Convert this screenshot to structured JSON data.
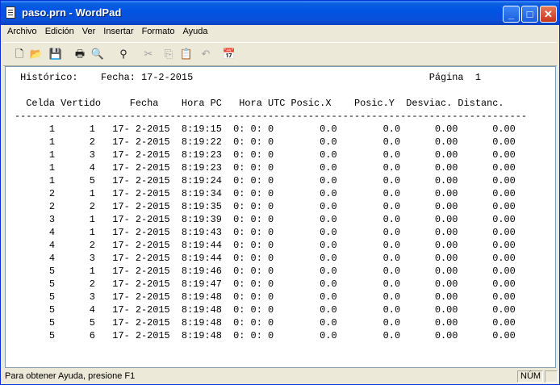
{
  "window": {
    "title": "paso.prn - WordPad",
    "minimize": "_",
    "maximize": "□",
    "close": "✕"
  },
  "menu": [
    "Archivo",
    "Edición",
    "Ver",
    "Insertar",
    "Formato",
    "Ayuda"
  ],
  "toolbar": [
    {
      "name": "new-icon",
      "glyph": "🗋"
    },
    {
      "name": "open-icon",
      "glyph": "📂"
    },
    {
      "name": "save-icon",
      "glyph": "💾"
    },
    {
      "name": "print-icon",
      "glyph": "🖶"
    },
    {
      "name": "print-preview-icon",
      "glyph": "🔍"
    },
    {
      "name": "find-icon",
      "glyph": "⚲"
    },
    {
      "name": "cut-icon",
      "glyph": "✂"
    },
    {
      "name": "copy-icon",
      "glyph": "⎘"
    },
    {
      "name": "paste-icon",
      "glyph": "📋"
    },
    {
      "name": "undo-icon",
      "glyph": "↶"
    },
    {
      "name": "insert-date-icon",
      "glyph": "📅"
    }
  ],
  "document": {
    "header": " Histórico:    Fecha: 17-2-2015                                         Página  1",
    "columns": "  Celda Vertido     Fecha    Hora PC   Hora UTC Posic.X    Posic.Y  Desviac. Distanc.",
    "separator": "-----------------------------------------------------------------------------------------",
    "rows": [
      "      1      1   17- 2-2015  8:19:15  0: 0: 0        0.0        0.0      0.00      0.00",
      "      1      2   17- 2-2015  8:19:22  0: 0: 0        0.0        0.0      0.00      0.00",
      "      1      3   17- 2-2015  8:19:23  0: 0: 0        0.0        0.0      0.00      0.00",
      "      1      4   17- 2-2015  8:19:23  0: 0: 0        0.0        0.0      0.00      0.00",
      "      1      5   17- 2-2015  8:19:24  0: 0: 0        0.0        0.0      0.00      0.00",
      "      2      1   17- 2-2015  8:19:34  0: 0: 0        0.0        0.0      0.00      0.00",
      "      2      2   17- 2-2015  8:19:35  0: 0: 0        0.0        0.0      0.00      0.00",
      "      3      1   17- 2-2015  8:19:39  0: 0: 0        0.0        0.0      0.00      0.00",
      "      4      1   17- 2-2015  8:19:43  0: 0: 0        0.0        0.0      0.00      0.00",
      "      4      2   17- 2-2015  8:19:44  0: 0: 0        0.0        0.0      0.00      0.00",
      "      4      3   17- 2-2015  8:19:44  0: 0: 0        0.0        0.0      0.00      0.00",
      "      5      1   17- 2-2015  8:19:46  0: 0: 0        0.0        0.0      0.00      0.00",
      "      5      2   17- 2-2015  8:19:47  0: 0: 0        0.0        0.0      0.00      0.00",
      "      5      3   17- 2-2015  8:19:48  0: 0: 0        0.0        0.0      0.00      0.00",
      "      5      4   17- 2-2015  8:19:48  0: 0: 0        0.0        0.0      0.00      0.00",
      "      5      5   17- 2-2015  8:19:48  0: 0: 0        0.0        0.0      0.00      0.00",
      "      5      6   17- 2-2015  8:19:48  0: 0: 0        0.0        0.0      0.00      0.00"
    ]
  },
  "status": {
    "help": "Para obtener Ayuda, presione F1",
    "num": "NÚM"
  }
}
